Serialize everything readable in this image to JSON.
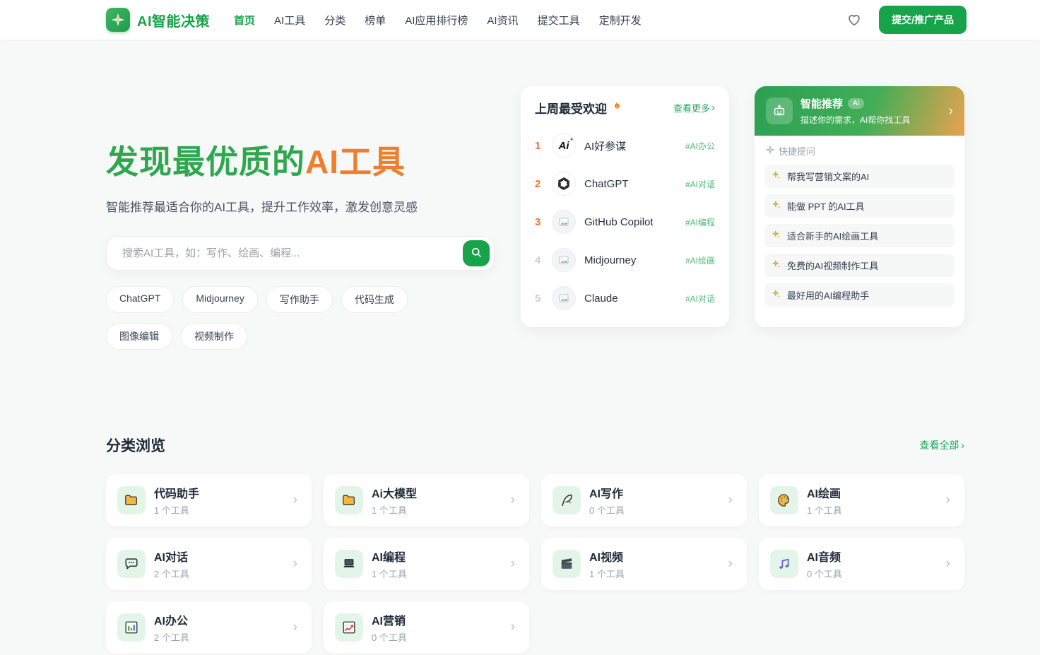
{
  "colors": {
    "primary_green": "#16a34a",
    "heading_green": "#2fa74f",
    "accent_orange": "#ee7f2e",
    "tag_green": "#4fb977",
    "gradient_card": "linear green #2ba052 to orange #e9a24e"
  },
  "header": {
    "logo_text": "AI智能决策",
    "logo_icon": "compass-icon",
    "nav": [
      {
        "label": "首页",
        "active": true
      },
      {
        "label": "AI工具",
        "active": false
      },
      {
        "label": "分类",
        "active": false
      },
      {
        "label": "榜单",
        "active": false
      },
      {
        "label": "AI应用排行榜",
        "active": false
      },
      {
        "label": "AI资讯",
        "active": false
      },
      {
        "label": "提交工具",
        "active": false
      },
      {
        "label": "定制开发",
        "active": false
      }
    ],
    "favorite_icon": "heart-icon",
    "submit_button": "提交/推广产品"
  },
  "hero": {
    "title_green": "发现最优质的",
    "title_orange": "AI工具",
    "subtitle": "智能推荐最适合你的AI工具，提升工作效率，激发创意灵感",
    "search_placeholder": "搜索AI工具，如：写作、绘画、编程...",
    "search_icon": "search-icon",
    "hot_tags": [
      "ChatGPT",
      "Midjourney",
      "写作助手",
      "代码生成",
      "图像编辑",
      "视频制作"
    ]
  },
  "popular": {
    "title": "上周最受欢迎",
    "title_icon": "flame-icon",
    "more_label": "查看更多",
    "more_arrow": "›",
    "items": [
      {
        "rank": "1",
        "name": "AI好参谋",
        "tag": "#AI办公",
        "logo": "ai-haocanmou-logo"
      },
      {
        "rank": "2",
        "name": "ChatGPT",
        "tag": "#AI对话",
        "logo": "openai-logo"
      },
      {
        "rank": "3",
        "name": "GitHub Copilot",
        "tag": "#AI编程",
        "logo": "broken-image-icon"
      },
      {
        "rank": "4",
        "name": "Midjourney",
        "tag": "#AI绘画",
        "logo": "broken-image-icon"
      },
      {
        "rank": "5",
        "name": "Claude",
        "tag": "#AI对话",
        "logo": "broken-image-icon"
      }
    ]
  },
  "recommend": {
    "title": "智能推荐",
    "badge": "AI",
    "subtitle": "描述你的需求，AI帮你找工具",
    "header_icon": "robot-icon",
    "arrow": "›",
    "quick_label": "快捷提问",
    "quick_label_icon": "sparkle-outline-icon",
    "question_icon": "sparkles-icon",
    "questions": [
      "帮我写营销文案的AI",
      "能做 PPT 的AI工具",
      "适合新手的AI绘画工具",
      "免费的AI视频制作工具",
      "最好用的AI编程助手"
    ]
  },
  "categories": {
    "title": "分类浏览",
    "view_all": "查看全部",
    "view_all_arrow": "›",
    "card_arrow": "›",
    "items": [
      {
        "name": "代码助手",
        "count": "1 个工具",
        "icon": "folder-icon"
      },
      {
        "name": "Ai大模型",
        "count": "1 个工具",
        "icon": "folder-icon"
      },
      {
        "name": "AI写作",
        "count": "0 个工具",
        "icon": "quill-icon"
      },
      {
        "name": "AI绘画",
        "count": "1 个工具",
        "icon": "palette-icon"
      },
      {
        "name": "AI对话",
        "count": "2 个工具",
        "icon": "chat-bubble-icon"
      },
      {
        "name": "AI编程",
        "count": "1 个工具",
        "icon": "laptop-icon"
      },
      {
        "name": "AI视频",
        "count": "1 个工具",
        "icon": "clapperboard-icon"
      },
      {
        "name": "AI音频",
        "count": "0 个工具",
        "icon": "music-notes-icon"
      },
      {
        "name": "AI办公",
        "count": "2 个工具",
        "icon": "bar-chart-icon"
      },
      {
        "name": "AI营销",
        "count": "0 个工具",
        "icon": "trend-chart-icon"
      }
    ]
  }
}
